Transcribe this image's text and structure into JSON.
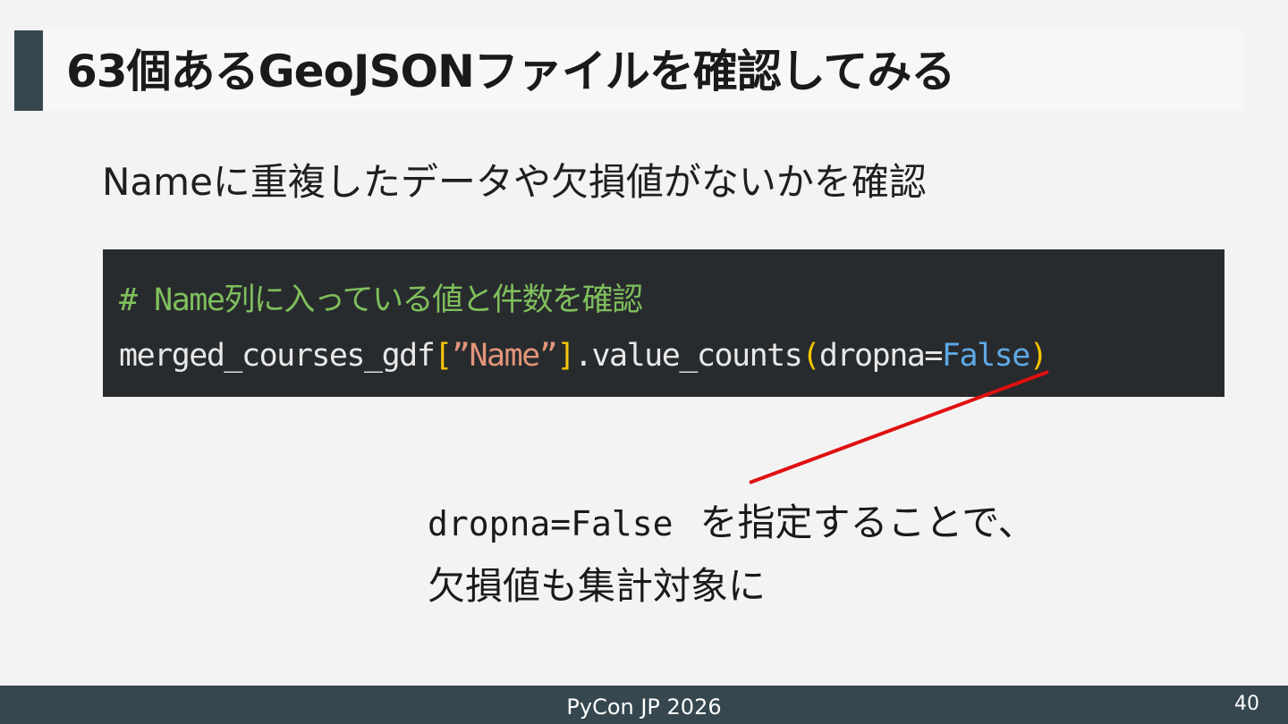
{
  "slide": {
    "title": "63個あるGeoJSONファイルを確認してみる",
    "subtitle": "Nameに重複したデータや欠損値がないかを確認"
  },
  "code": {
    "comment": "# Name列に入っている値と件数を確認",
    "line2": {
      "var": "merged_courses_gdf",
      "open_bracket": "[",
      "string": "”Name”",
      "close_bracket": "]",
      "method": ".value_counts",
      "open_paren": "(",
      "arg": "dropna=",
      "value": "False",
      "close_paren": ")"
    }
  },
  "note": {
    "code": "dropna=False",
    "line1_text": "を指定することで、",
    "line2_text": "欠損値も集計対象に"
  },
  "footer": {
    "title": "PyCon JP 2026",
    "page": "40"
  },
  "colors": {
    "title_accent": "#36474f",
    "footer_bg": "#36474f",
    "code_bg": "#282b2e",
    "annotation_line": "#e01010"
  }
}
